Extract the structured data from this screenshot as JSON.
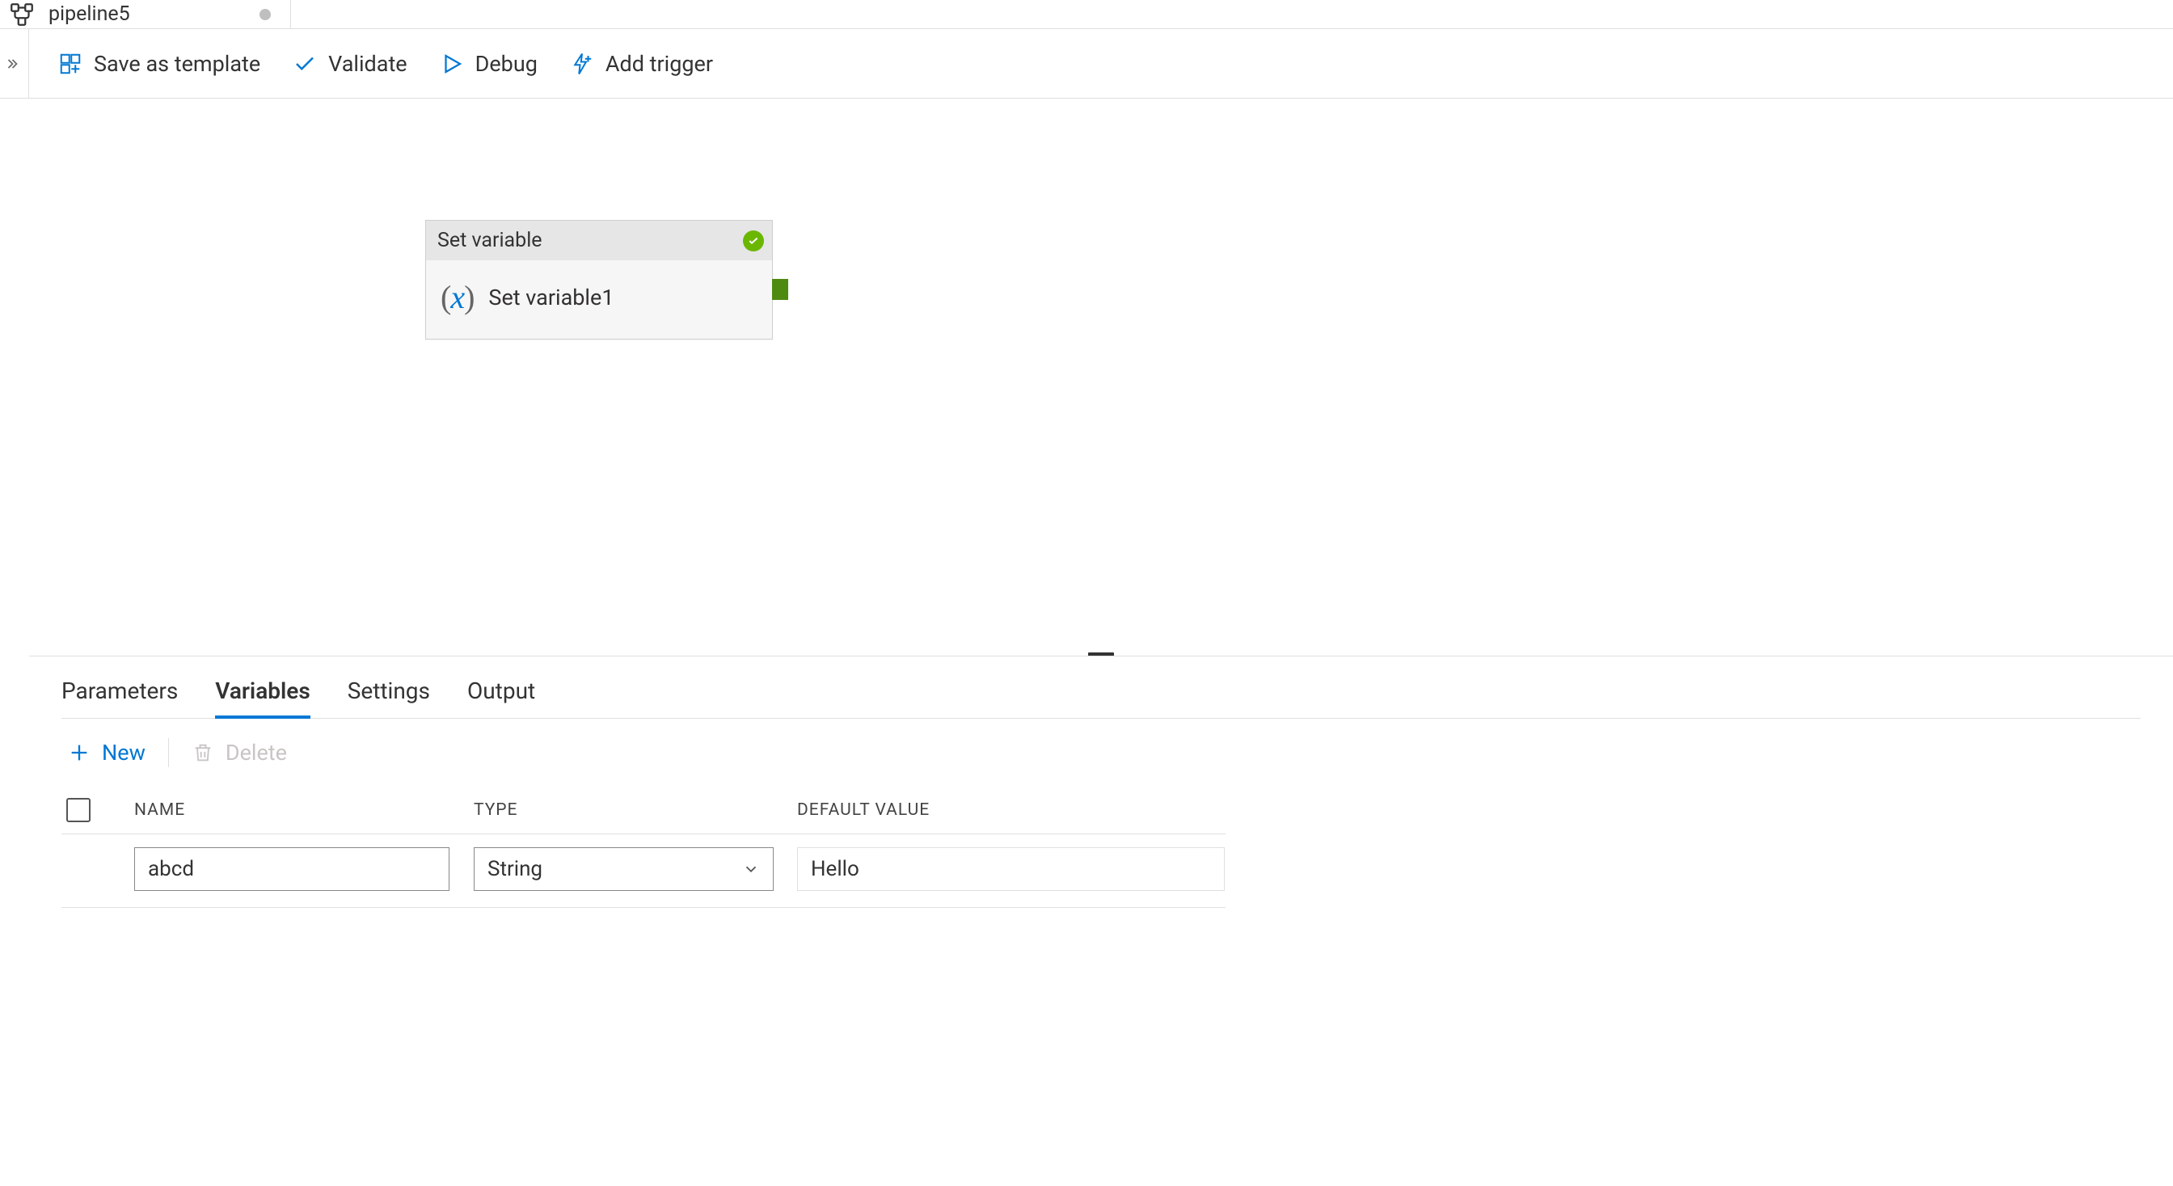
{
  "tab": {
    "name": "pipeline5",
    "dirty": true
  },
  "toolbar": {
    "save_template": "Save as template",
    "validate": "Validate",
    "debug": "Debug",
    "add_trigger": "Add trigger"
  },
  "canvas": {
    "node": {
      "type_label": "Set variable",
      "name": "Set variable1",
      "status": "ok"
    }
  },
  "props": {
    "tabs": {
      "parameters": "Parameters",
      "variables": "Variables",
      "settings": "Settings",
      "output": "Output",
      "active": "variables"
    },
    "actions": {
      "new": "New",
      "delete": "Delete"
    },
    "variables": {
      "headers": {
        "name": "NAME",
        "type": "TYPE",
        "default": "DEFAULT VALUE"
      },
      "rows": [
        {
          "name": "abcd",
          "type": "String",
          "default": "Hello"
        }
      ]
    }
  }
}
